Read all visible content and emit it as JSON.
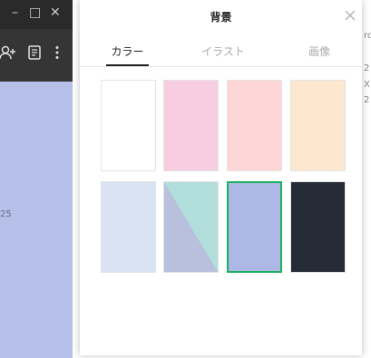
{
  "background_window": {
    "window_controls": [
      "–",
      "□",
      "✕"
    ],
    "side_text": "25",
    "edge_chars": [
      "ro",
      "2",
      "X",
      "2"
    ],
    "colors": {
      "titlebar": "#2a2a2a",
      "toolbar": "#353535",
      "content": "#b6c0e8"
    }
  },
  "dialog": {
    "title": "背景",
    "tabs": [
      {
        "label": "カラー",
        "active": true
      },
      {
        "label": "イラスト",
        "active": false
      },
      {
        "label": "画像",
        "active": false
      }
    ],
    "swatches": [
      {
        "name": "white",
        "color": "#ffffff",
        "selected": false
      },
      {
        "name": "pink",
        "color": "#f6cde1",
        "selected": false
      },
      {
        "name": "salmon",
        "color": "#ffd6d6",
        "selected": false
      },
      {
        "name": "peach",
        "color": "#fde8cf",
        "selected": false
      },
      {
        "name": "light-blue",
        "color": "#d8e2f1",
        "selected": false
      },
      {
        "name": "teal-lavender",
        "color": "#b8c0dd",
        "accent": "#b2dedc",
        "selected": false
      },
      {
        "name": "periwinkle",
        "color": "#aeb8e6",
        "selected": true
      },
      {
        "name": "dark",
        "color": "#242a36",
        "selected": false
      }
    ],
    "accent_color": "#1db05f"
  }
}
